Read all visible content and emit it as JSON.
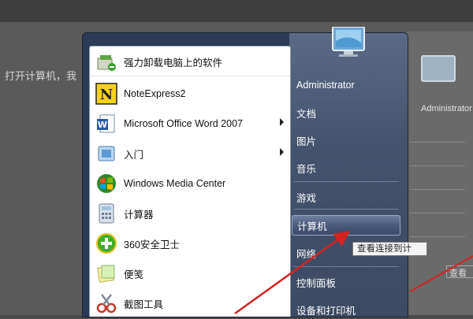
{
  "background": {
    "article_text": "打开计算机，我",
    "right_window_user": "Administrator",
    "right_button_label": "查看"
  },
  "start_menu": {
    "programs": [
      {
        "label": "强力卸载电脑上的软件",
        "icon": "uninstall-icon",
        "has_submenu": false
      },
      {
        "label": "NoteExpress2",
        "icon": "noteexpress-icon",
        "has_submenu": false
      },
      {
        "label": "Microsoft Office Word 2007",
        "icon": "word-icon",
        "has_submenu": true
      },
      {
        "label": "入门",
        "icon": "getting-started-icon",
        "has_submenu": true
      },
      {
        "label": "Windows Media Center",
        "icon": "media-center-icon",
        "has_submenu": false
      },
      {
        "label": "计算器",
        "icon": "calculator-icon",
        "has_submenu": false
      },
      {
        "label": "360安全卫士",
        "icon": "360-safe-icon",
        "has_submenu": false
      },
      {
        "label": "便笺",
        "icon": "sticky-notes-icon",
        "has_submenu": false
      },
      {
        "label": "截图工具",
        "icon": "snipping-tool-icon",
        "has_submenu": false
      }
    ],
    "right_items": [
      {
        "label": "Administrator"
      },
      {
        "label": "文档"
      },
      {
        "label": "图片"
      },
      {
        "label": "音乐"
      },
      {
        "label": "游戏"
      },
      {
        "label": "计算机"
      },
      {
        "label": "网络"
      },
      {
        "label": "控制面板"
      },
      {
        "label": "设备和打印机"
      }
    ],
    "selected_item": "计算机",
    "tooltip": "查看连接到计"
  },
  "colors": {
    "annotation_arrow": "#d4231f",
    "menu_frame": "#2b3a55"
  }
}
